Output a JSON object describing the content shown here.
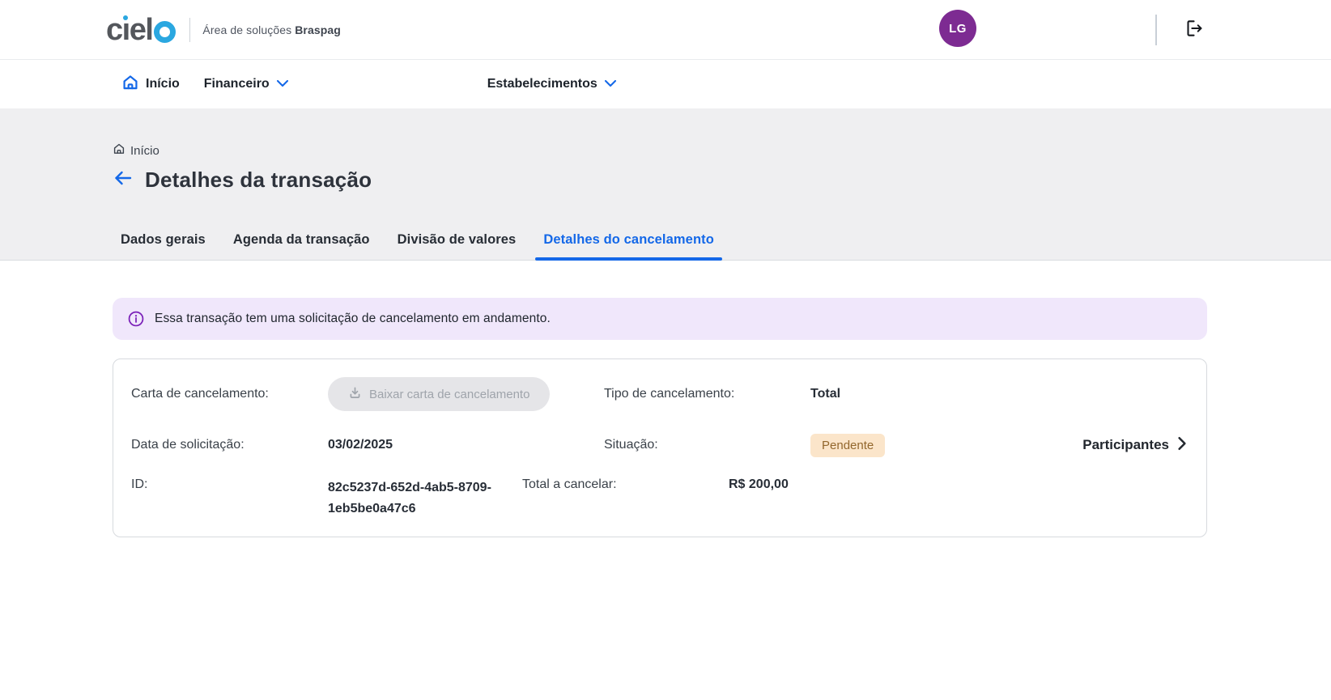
{
  "header": {
    "brand_text": "ciel",
    "brand_subtitle": "Área de soluções",
    "brand_subtitle_bold": "Braspag",
    "avatar_initials": "LG"
  },
  "nav": {
    "items": [
      {
        "label": "Início"
      },
      {
        "label": "Financeiro"
      },
      {
        "label": "Estabelecimentos"
      }
    ]
  },
  "breadcrumb": {
    "label": "Início"
  },
  "page": {
    "title": "Detalhes da transação"
  },
  "tabs": [
    {
      "label": "Dados gerais",
      "active": false
    },
    {
      "label": "Agenda da transação",
      "active": false
    },
    {
      "label": "Divisão de valores",
      "active": false
    },
    {
      "label": "Detalhes do cancelamento",
      "active": true
    }
  ],
  "banner": {
    "text": "Essa transação tem uma solicitação de cancelamento em andamento."
  },
  "details_card": {
    "carta_label": "Carta de cancelamento:",
    "download_button_label": "Baixar carta de cancelamento",
    "tipo_label": "Tipo de cancelamento:",
    "tipo_value": "Total",
    "data_label": "Data de solicitação:",
    "data_value": "03/02/2025",
    "situacao_label": "Situação:",
    "situacao_badge": "Pendente",
    "participantes_label": "Participantes",
    "id_label": "ID:",
    "id_value": "82c5237d-652d-4ab5-8709-1eb5be0a47c6",
    "total_label": "Total a cancelar:",
    "total_value": "R$ 200,00"
  },
  "colors": {
    "accent_blue": "#1468e8",
    "brand_light_blue": "#2aa7e0",
    "avatar_purple": "#7d2b92",
    "banner_bg": "#f0e7fb",
    "banner_icon_purple": "#7a1fb8",
    "badge_bg": "#fbe5ca",
    "badge_text": "#93672d",
    "section_gray": "#efeff1",
    "disabled_button_bg": "#e5e5e8"
  }
}
